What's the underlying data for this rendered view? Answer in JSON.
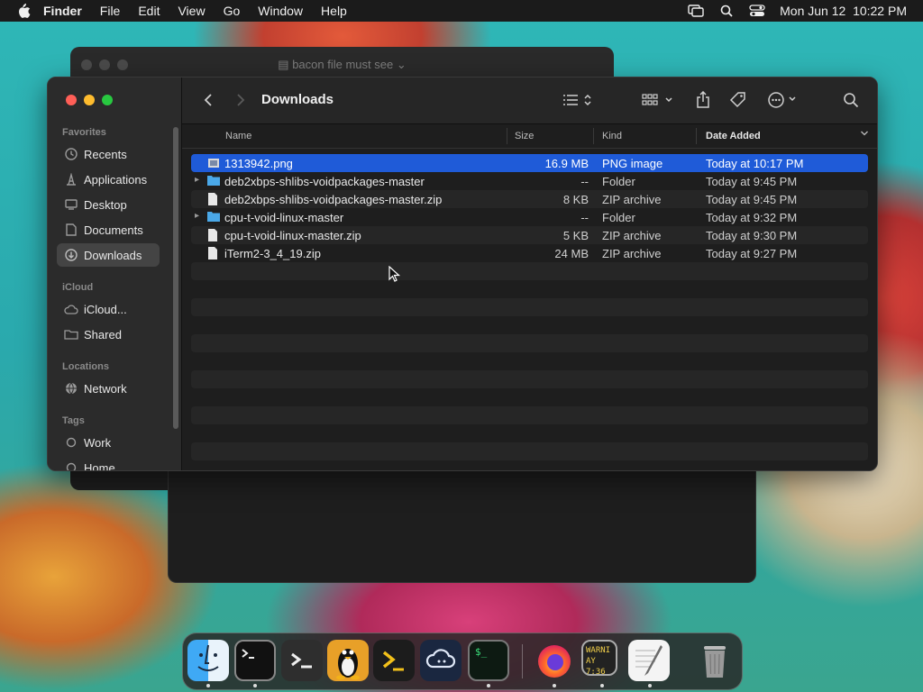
{
  "menubar": {
    "app": "Finder",
    "items": [
      "File",
      "Edit",
      "View",
      "Go",
      "Window",
      "Help"
    ],
    "clock": "Mon Jun 12  10:22 PM"
  },
  "background_window": {
    "title": "bacon file must see"
  },
  "sidebar": {
    "favorites_label": "Favorites",
    "favorites": [
      {
        "label": "Recents",
        "icon": "clock-icon"
      },
      {
        "label": "Applications",
        "icon": "applications-icon"
      },
      {
        "label": "Desktop",
        "icon": "desktop-icon"
      },
      {
        "label": "Documents",
        "icon": "document-icon"
      },
      {
        "label": "Downloads",
        "icon": "downloads-icon",
        "selected": true
      }
    ],
    "icloud_label": "iCloud",
    "icloud": [
      {
        "label": "iCloud...",
        "icon": "cloud-icon"
      },
      {
        "label": "Shared",
        "icon": "shared-folder-icon"
      }
    ],
    "locations_label": "Locations",
    "locations": [
      {
        "label": "Network",
        "icon": "globe-icon"
      }
    ],
    "tags_label": "Tags",
    "tags": [
      {
        "label": "Work",
        "icon": "tag-circle-icon"
      },
      {
        "label": "Home",
        "icon": "tag-circle-icon"
      }
    ]
  },
  "toolbar": {
    "title": "Downloads"
  },
  "columns": {
    "name": "Name",
    "size": "Size",
    "kind": "Kind",
    "date": "Date Added"
  },
  "files": [
    {
      "name": "1313942.png",
      "size": "16.9 MB",
      "kind": "PNG image",
      "date": "Today at 10:17 PM",
      "type": "image",
      "selected": true
    },
    {
      "name": "deb2xbps-shlibs-voidpackages-master",
      "size": "--",
      "kind": "Folder",
      "date": "Today at 9:45 PM",
      "type": "folder"
    },
    {
      "name": "deb2xbps-shlibs-voidpackages-master.zip",
      "size": "8 KB",
      "kind": "ZIP archive",
      "date": "Today at 9:45 PM",
      "type": "file"
    },
    {
      "name": "cpu-t-void-linux-master",
      "size": "--",
      "kind": "Folder",
      "date": "Today at 9:32 PM",
      "type": "folder"
    },
    {
      "name": "cpu-t-void-linux-master.zip",
      "size": "5 KB",
      "kind": "ZIP archive",
      "date": "Today at 9:30 PM",
      "type": "file"
    },
    {
      "name": "iTerm2-3_4_19.zip",
      "size": "24 MB",
      "kind": "ZIP archive",
      "date": "Today at 9:27 PM",
      "type": "file"
    }
  ],
  "dock": {
    "apps": [
      "finder",
      "terminal",
      "powershell",
      "tux",
      "prompt",
      "cloud-app",
      "terminal-green",
      "firefox",
      "console",
      "textedit",
      "trash"
    ],
    "console_text_1": "WARNI",
    "console_text_2": "AY 7:36"
  }
}
